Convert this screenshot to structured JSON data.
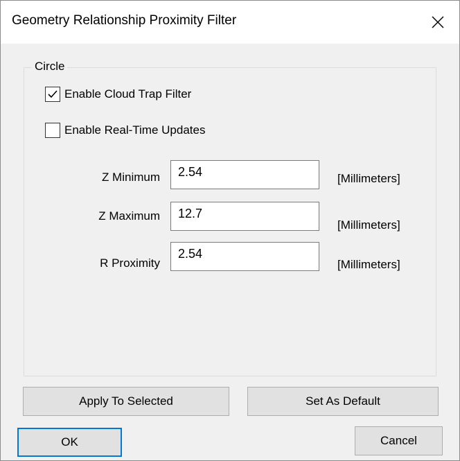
{
  "window": {
    "title": "Geometry Relationship Proximity Filter",
    "close_icon": "close-icon"
  },
  "group": {
    "label": "Circle"
  },
  "checkboxes": [
    {
      "label": "Enable Cloud Trap Filter",
      "checked": true
    },
    {
      "label": "Enable Real-Time Updates",
      "checked": false
    }
  ],
  "fields": [
    {
      "label": "Z Minimum",
      "value": "2.54",
      "unit": "[Millimeters]"
    },
    {
      "label": "Z Maximum",
      "value": "12.7",
      "unit": "[Millimeters]"
    },
    {
      "label": "R Proximity",
      "value": "2.54",
      "unit": "[Millimeters]"
    }
  ],
  "buttons": {
    "apply_selected": "Apply To Selected",
    "set_default": "Set As Default",
    "ok": "OK",
    "cancel": "Cancel"
  },
  "colors": {
    "default_button_border": "#0078d7"
  }
}
